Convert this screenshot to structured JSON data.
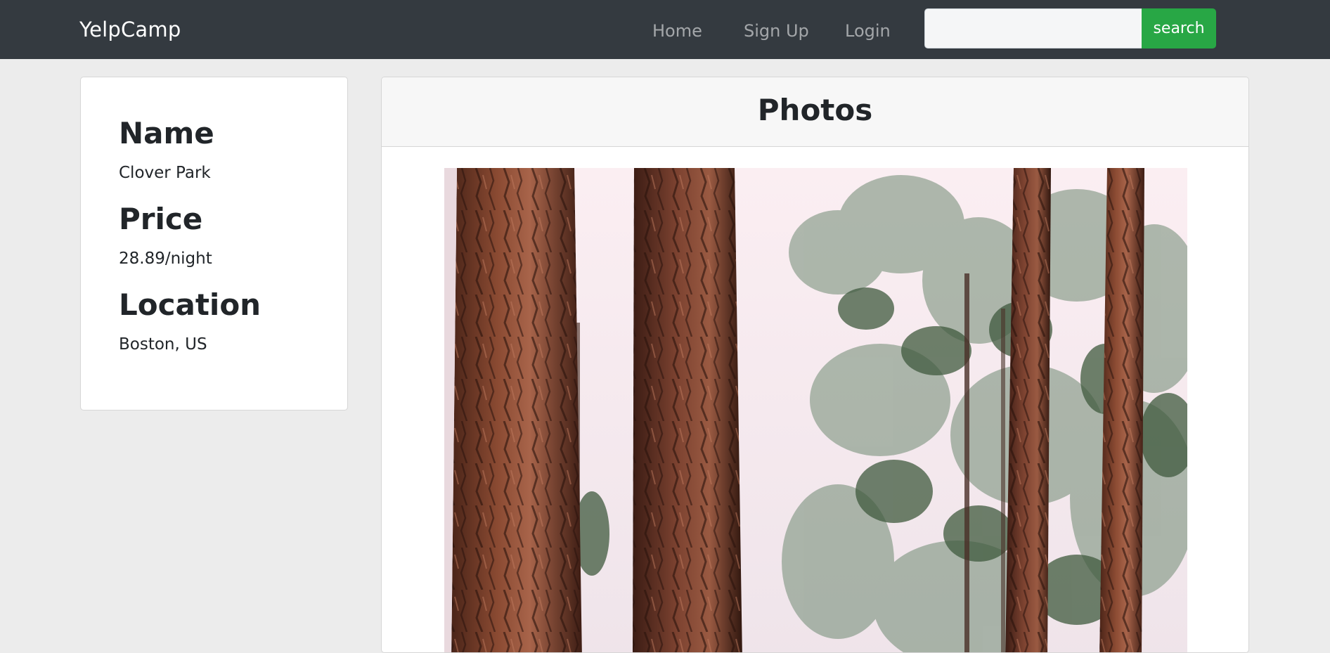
{
  "navbar": {
    "brand": "YelpCamp",
    "links": [
      {
        "label": "Home"
      },
      {
        "label": "Sign Up"
      },
      {
        "label": "Login"
      }
    ],
    "search": {
      "value": "",
      "button_label": "search"
    }
  },
  "campground": {
    "name_heading": "Name",
    "name": "Clover Park",
    "price_heading": "Price",
    "price": "28.89/night",
    "location_heading": "Location",
    "location": "Boston, US"
  },
  "photos": {
    "title": "Photos",
    "image": "pine-forest-photo"
  },
  "colors": {
    "navbar_bg": "#343a40",
    "page_bg": "#ececec",
    "search_button": "#28a745",
    "text": "#212529"
  }
}
